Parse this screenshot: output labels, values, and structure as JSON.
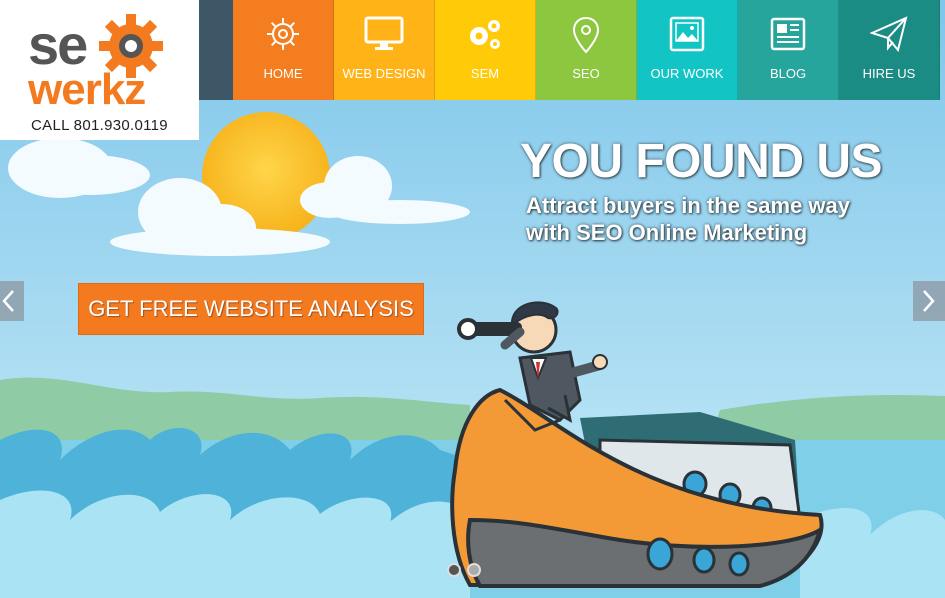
{
  "brand": {
    "logo_top": "se",
    "logo_bottom": "werkz",
    "call_text": "CALL 801.930.0119"
  },
  "nav": {
    "items": [
      {
        "label": "HOME",
        "icon": "gear-icon",
        "color": "#f47d1f"
      },
      {
        "label": "WEB DESIGN",
        "icon": "monitor-icon",
        "color": "#ffb316"
      },
      {
        "label": "SEM",
        "icon": "gears-icon",
        "color": "#ffca08"
      },
      {
        "label": "SEO",
        "icon": "location-pin-icon",
        "color": "#8dc63f"
      },
      {
        "label": "OUR WORK",
        "icon": "image-icon",
        "color": "#13c4c5"
      },
      {
        "label": "BLOG",
        "icon": "newspaper-icon",
        "color": "#25a59b"
      },
      {
        "label": "HIRE US",
        "icon": "paper-plane-icon",
        "color": "#1b8c84"
      }
    ]
  },
  "hero": {
    "headline": "YOU FOUND US",
    "subline_1": "Attract buyers in the same way",
    "subline_2": "with SEO Online Marketing",
    "cta_label": "GET FREE WEBSITE ANALYSIS",
    "prev_icon": "chevron-left-icon",
    "next_icon": "chevron-right-icon",
    "slides_total": 2,
    "active_slide": 1
  },
  "colors": {
    "accent_orange": "#f47a20",
    "sky": "#8fd3f1"
  }
}
